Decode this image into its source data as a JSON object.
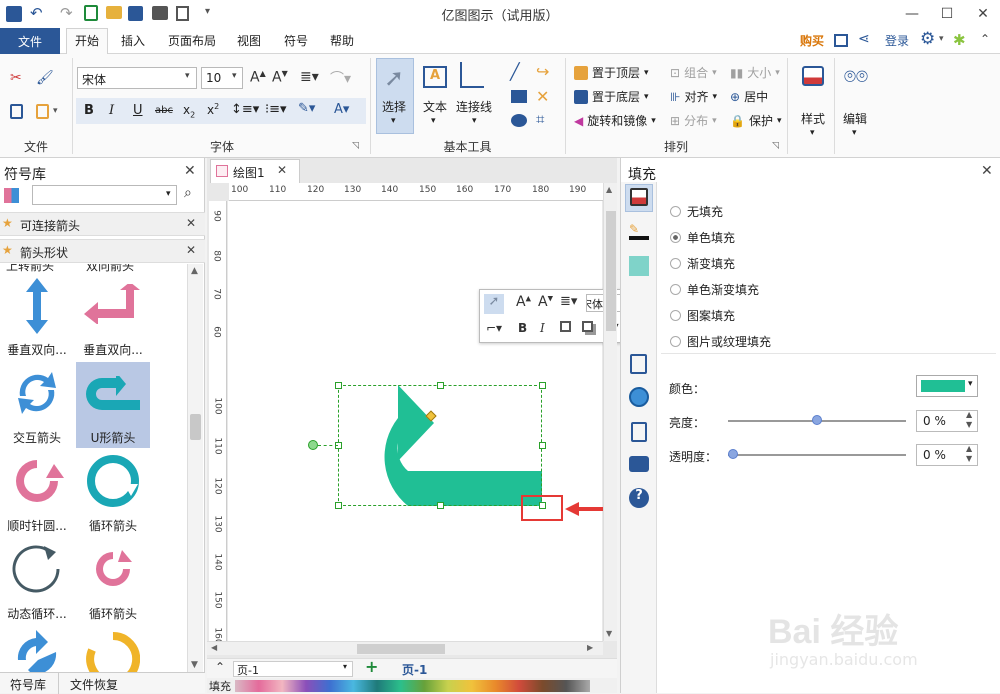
{
  "app": {
    "title": "亿图图示（试用版）",
    "buy": "购买",
    "login": "登录"
  },
  "menu": {
    "file": "文件",
    "tabs": [
      "开始",
      "插入",
      "页面布局",
      "视图",
      "符号",
      "帮助"
    ]
  },
  "ribbon": {
    "font_name": "宋体",
    "font_size": "10",
    "group_labels": {
      "file": "文件",
      "font": "字体",
      "basic_tools": "基本工具",
      "arrange": "排列"
    },
    "tools": {
      "select": "选择",
      "text": "文本",
      "connector": "连接线"
    },
    "arrange": {
      "bring_top": "置于顶层",
      "send_bottom": "置于底层",
      "rotate_mirror": "旋转和镜像",
      "group": "组合",
      "align": "对齐",
      "distribute": "分布",
      "size": "大小",
      "center": "居中",
      "protect": "保护"
    },
    "style": "样式",
    "edit": "编辑"
  },
  "left_panel": {
    "title": "符号库",
    "search_placeholder": "",
    "libraries": [
      "可连接箭头",
      "箭头形状"
    ],
    "partial_labels": [
      "上转箭头",
      "双向箭头"
    ],
    "shapes": [
      {
        "label": "垂直双向...",
        "color": "#3d8fd6"
      },
      {
        "label": "垂直双向...",
        "color": "#e0739a"
      },
      {
        "label": "交互箭头",
        "color": "#3d8fd6"
      },
      {
        "label": "U形箭头",
        "color": "#1aa7b5"
      },
      {
        "label": "顺时针圆...",
        "color": "#e0739a"
      },
      {
        "label": "循环箭头",
        "color": "#1aa7b5"
      },
      {
        "label": "动态循环...",
        "color": "#455a64"
      },
      {
        "label": "循环箭头",
        "color": "#e0739a"
      },
      {
        "label": "",
        "color": "#3d8fd6"
      },
      {
        "label": "",
        "color": "#f0b429"
      }
    ],
    "bottom_tabs": [
      "符号库",
      "文件恢复"
    ]
  },
  "document": {
    "tab": "绘图1",
    "ruler_top": [
      "100",
      "110",
      "120",
      "130",
      "140",
      "150",
      "160",
      "170",
      "180",
      "190"
    ],
    "ruler_left": [
      "90",
      "80",
      "70",
      "60",
      "100",
      "110",
      "120",
      "130",
      "140",
      "150",
      "160"
    ],
    "page_select": "页-1",
    "page_tab": "页-1",
    "fill_label": "填充",
    "shape_color": "#20bf95",
    "mini_font": "宋体"
  },
  "right_panel": {
    "title": "填充",
    "options": [
      "无填充",
      "单色填充",
      "渐变填充",
      "单色渐变填充",
      "图案填充",
      "图片或纹理填充"
    ],
    "selected": "单色填充",
    "color_label": "颜色：",
    "color_value": "#20bf95",
    "brightness_label": "亮度：",
    "brightness_value": "0 %",
    "transparency_label": "透明度：",
    "transparency_value": "0 %",
    "brightness_level": 0.5,
    "transparency_level": 0.0
  },
  "watermark": {
    "text": "Bai 经验",
    "url": "jingyan.baidu.com"
  }
}
